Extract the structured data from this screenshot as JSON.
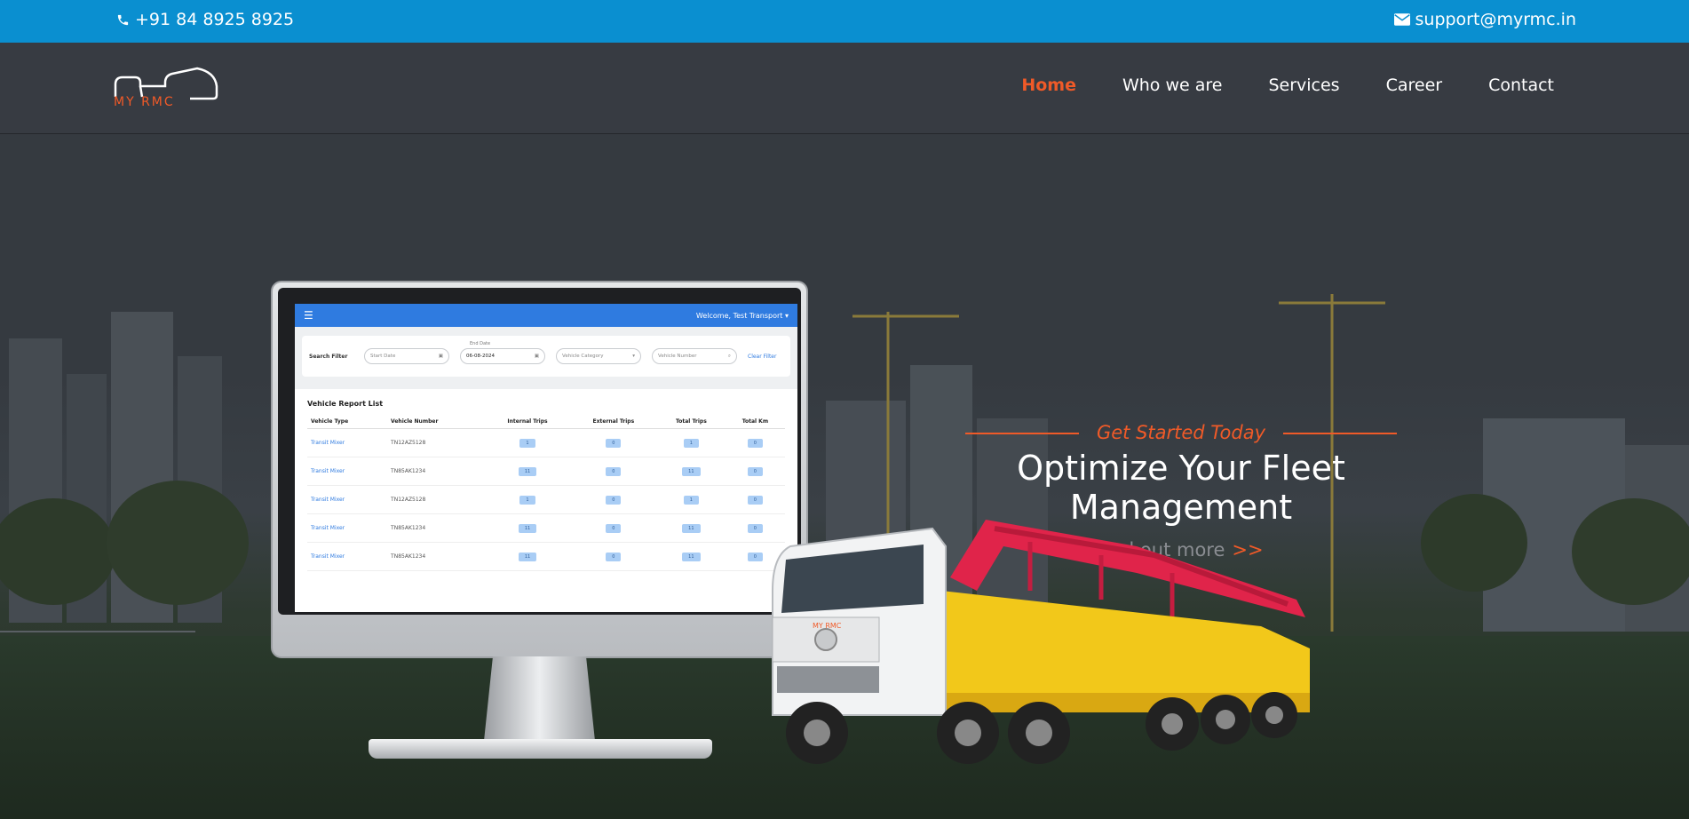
{
  "topbar": {
    "phone": "+91 84 8925 8925",
    "email": "support@myrmc.in",
    "phone_icon": "phone-icon",
    "email_icon": "envelope-icon",
    "bg_color": "#0a8fd0"
  },
  "brand": {
    "logo_text": "MY RMC",
    "accent_color": "#f05a28"
  },
  "nav": {
    "items": [
      {
        "label": "Home",
        "active": true
      },
      {
        "label": "Who we are",
        "active": false
      },
      {
        "label": "Services",
        "active": false
      },
      {
        "label": "Career",
        "active": false
      },
      {
        "label": "Contact",
        "active": false
      }
    ]
  },
  "hero": {
    "tagline": "Get Started Today",
    "headline": "Optimize Your Fleet Management",
    "cta": "find out more",
    "cta_arrow": ">>"
  },
  "dashboard": {
    "welcome": "Welcome, Test Transport",
    "filter_label": "Search Filter",
    "start_date": "Start Date",
    "end_date_caption": "End Date",
    "end_date_value": "06-08-2024",
    "vehicle_category": "Vehicle Category",
    "vehicle_number": "Vehicle Number",
    "clear_filter": "Clear Filter",
    "report_title": "Vehicle Report List",
    "columns": [
      "Vehicle Type",
      "Vehicle Number",
      "Internal Trips",
      "External Trips",
      "Total Trips",
      "Total Km"
    ],
    "rows": [
      [
        "Transit Mixer",
        "TN12AZ5128",
        "1",
        "0",
        "1",
        "0"
      ],
      [
        "Transit Mixer",
        "TN85AK1234",
        "11",
        "0",
        "11",
        "0"
      ],
      [
        "Transit Mixer",
        "TN12AZ5128",
        "1",
        "0",
        "1",
        "0"
      ],
      [
        "Transit Mixer",
        "TN85AK1234",
        "11",
        "0",
        "11",
        "0"
      ],
      [
        "Transit Mixer",
        "TN85AK1234",
        "11",
        "0",
        "11",
        "0"
      ]
    ]
  },
  "truck_logo_text": "MY RMC"
}
